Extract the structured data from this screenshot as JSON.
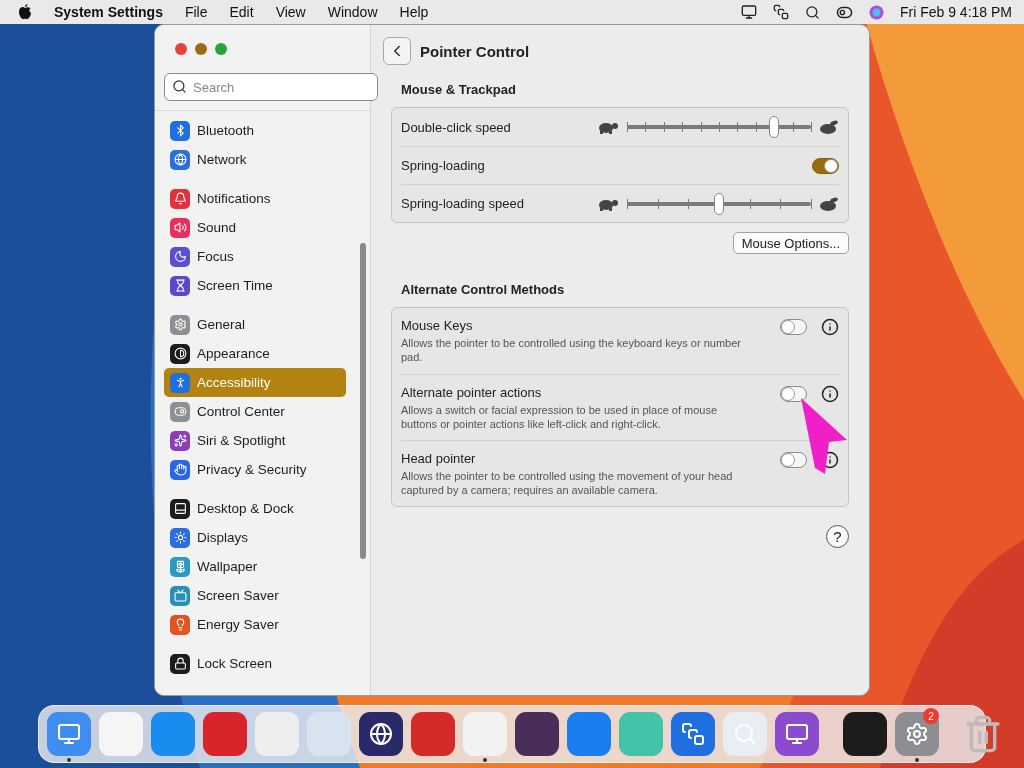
{
  "menu_bar": {
    "app_name": "System Settings",
    "menus": [
      "File",
      "Edit",
      "View",
      "Window",
      "Help"
    ],
    "clock": "Fri Feb 9  4:18 PM"
  },
  "sidebar": {
    "search": {
      "placeholder": "Search"
    },
    "groups": [
      [
        {
          "label": "Bluetooth",
          "selected": false,
          "color": "#1f6fe0"
        },
        {
          "label": "Network",
          "selected": false,
          "color": "#2a6ee0"
        }
      ],
      [
        {
          "label": "Notifications",
          "selected": false,
          "color": "#e0323b"
        },
        {
          "label": "Sound",
          "selected": false,
          "color": "#e2325a"
        },
        {
          "label": "Focus",
          "selected": false,
          "color": "#5a4fcf"
        },
        {
          "label": "Screen Time",
          "selected": false,
          "color": "#5a48c8"
        }
      ],
      [
        {
          "label": "General",
          "selected": false,
          "color": "#8e8e93"
        },
        {
          "label": "Appearance",
          "selected": false,
          "color": "#1c1c1e"
        },
        {
          "label": "Accessibility",
          "selected": true,
          "color": "#1f6fe0"
        },
        {
          "label": "Control Center",
          "selected": false,
          "color": "#8e8e93"
        },
        {
          "label": "Siri & Spotlight",
          "selected": false,
          "color": "#8a3fb8"
        },
        {
          "label": "Privacy & Security",
          "selected": false,
          "color": "#2767e3"
        }
      ],
      [
        {
          "label": "Desktop & Dock",
          "selected": false,
          "color": "#1c1c1e"
        },
        {
          "label": "Displays",
          "selected": false,
          "color": "#2a6ee0"
        },
        {
          "label": "Wallpaper",
          "selected": false,
          "color": "#2a9bc0"
        },
        {
          "label": "Screen Saver",
          "selected": false,
          "color": "#2a8fb8"
        },
        {
          "label": "Energy Saver",
          "selected": false,
          "color": "#e0541f"
        }
      ],
      [
        {
          "label": "Lock Screen",
          "selected": false,
          "color": "#1c1c1e"
        }
      ]
    ]
  },
  "content": {
    "title": "Pointer Control",
    "sections": [
      {
        "heading": "Mouse & Trackpad",
        "rows": [
          {
            "kind": "slider",
            "label": "Double-click speed",
            "level": 0.8
          },
          {
            "kind": "toggle",
            "label": "Spring-loading",
            "on": true
          },
          {
            "kind": "slider",
            "label": "Spring-loading speed",
            "level": 0.5
          }
        ],
        "button": "Mouse Options..."
      },
      {
        "heading": "Alternate Control Methods",
        "rows": [
          {
            "kind": "option",
            "label": "Mouse Keys",
            "description": "Allows the pointer to be controlled using the keyboard keys or number pad.",
            "on": false
          },
          {
            "kind": "option",
            "label": "Alternate pointer actions",
            "description": "Allows a switch or facial expression to be used in place of mouse buttons or pointer actions like left-click and right-click.",
            "on": false
          },
          {
            "kind": "option",
            "label": "Head pointer",
            "description": "Allows the pointer to be controlled using the movement of your head captured by a camera; requires an available camera.",
            "on": false
          }
        ]
      }
    ],
    "help": "?"
  },
  "dock": {
    "apps": [
      {
        "running": true
      },
      {
        "running": false
      },
      {
        "running": false
      },
      {
        "running": false
      },
      {
        "running": false
      },
      {
        "running": false
      },
      {
        "running": false
      },
      {
        "running": false
      },
      {
        "running": true
      },
      {
        "running": false
      },
      {
        "running": false
      },
      {
        "running": false
      },
      {
        "running": false
      },
      {
        "running": false
      },
      {
        "running": false
      },
      {
        "running": false
      },
      {
        "running": true,
        "badge": "2"
      },
      {
        "running": false
      }
    ]
  }
}
